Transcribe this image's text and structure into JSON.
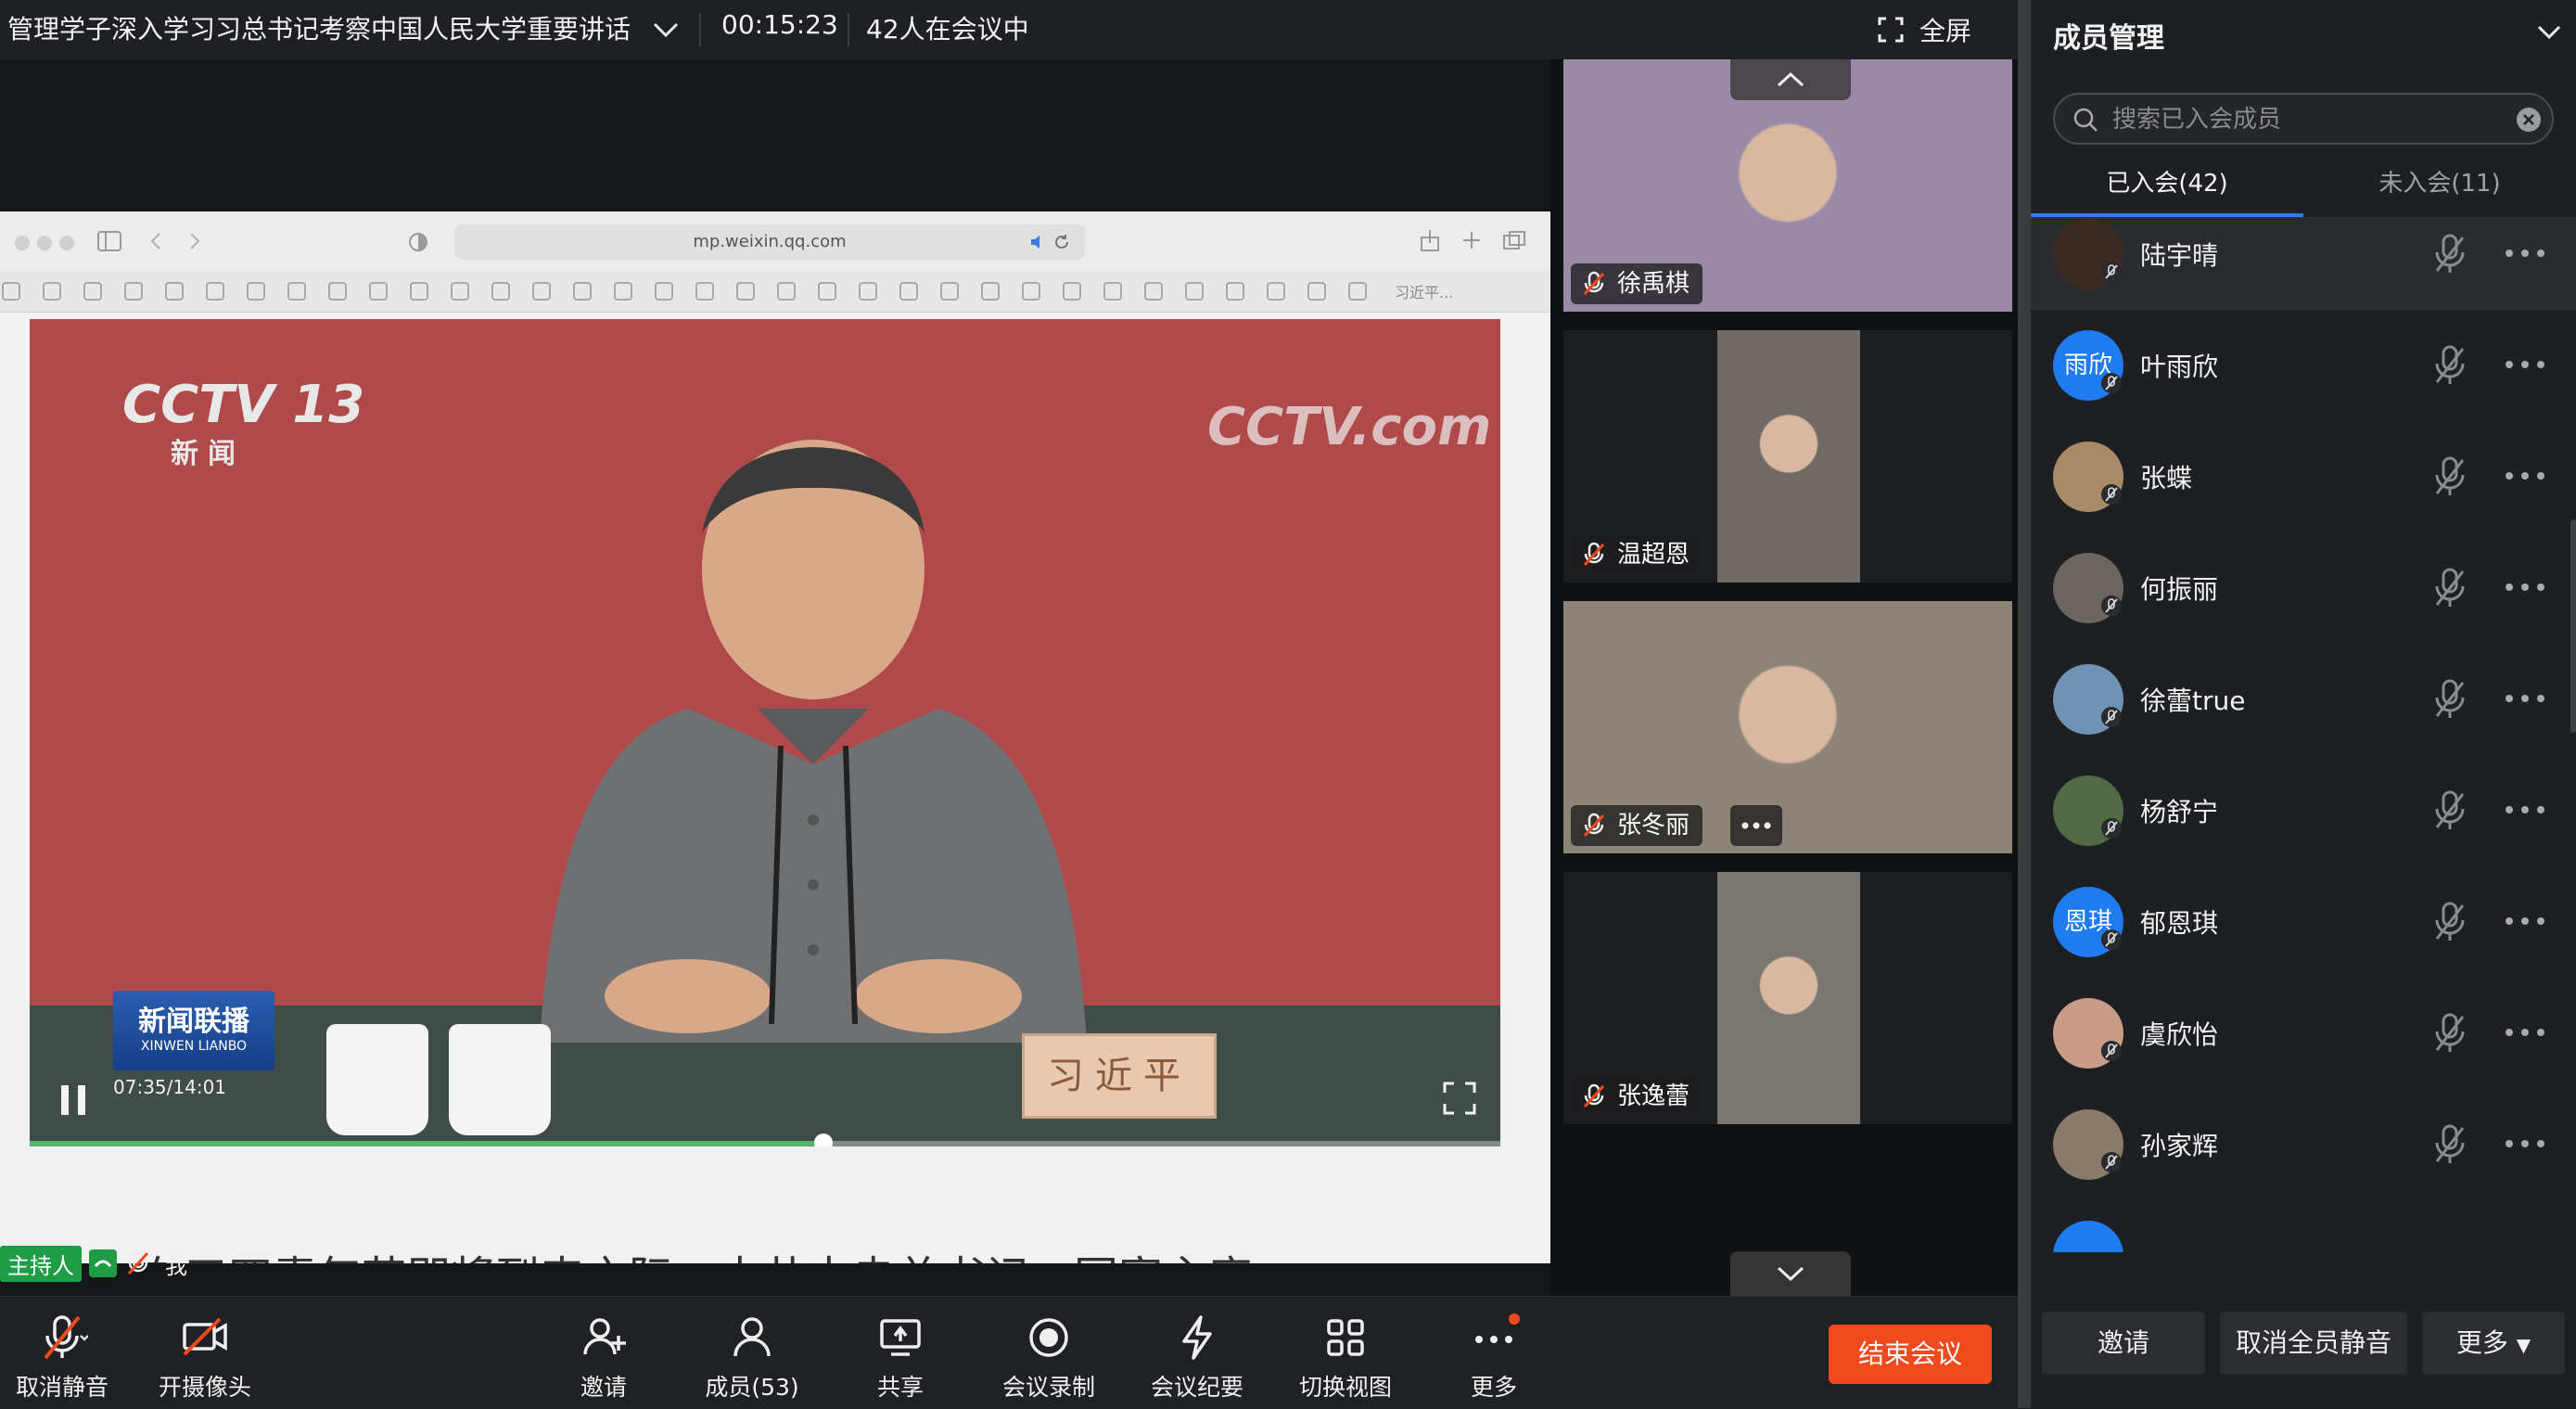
{
  "topbar": {
    "meeting_title": "管理学子深入学习习总书记考察中国人民大学重要讲话",
    "timer": "00:15:23",
    "participants": "42人在会议中",
    "fullscreen_label": "全屏"
  },
  "shared_screen": {
    "address": "mp.weixin.qq.com",
    "bookmark_label": "习近平...",
    "video": {
      "channel_logo": "CCTV 13",
      "channel_sub": "新闻",
      "watermark": "CCTV.com",
      "nameplate": "习近平",
      "program_logo": "新闻联播",
      "program_logo_sub": "XINWEN LIANBO",
      "time": "07:35/14:01",
      "progress": 0.54
    },
    "article_snippet": "在五四青年节即将到来之际，中共中央总书记、国家主席"
  },
  "host_row": {
    "host_badge": "主持人",
    "me_label": "我"
  },
  "video_tiles": [
    {
      "name": "徐禹棋",
      "bg": "#9a8aa8",
      "has_more": false
    },
    {
      "name": "温超恩",
      "bg": "#6f6a64",
      "has_more": false
    },
    {
      "name": "张冬丽",
      "bg": "#8d8478",
      "has_more": true
    },
    {
      "name": "张逸蕾",
      "bg": "#7a7672",
      "has_more": false
    }
  ],
  "toolbar": {
    "unmute": "取消静音",
    "camera": "开摄像头",
    "invite": "邀请",
    "members": "成员(53)",
    "share": "共享",
    "record": "会议录制",
    "minutes": "会议纪要",
    "switch_view": "切换视图",
    "more": "更多",
    "end_meeting": "结束会议"
  },
  "panel": {
    "title": "成员管理",
    "search_placeholder": "搜索已入会成员",
    "tab_joined": "已入会(42)",
    "tab_not_joined": "未入会(11)",
    "members": [
      {
        "name": "陆宇晴",
        "avatar_text": "",
        "avatar_bg": "#3b2a22"
      },
      {
        "name": "叶雨欣",
        "avatar_text": "雨欣",
        "avatar_bg": "#1f7cf0"
      },
      {
        "name": "张蝶",
        "avatar_text": "",
        "avatar_bg": "#a98a66"
      },
      {
        "name": "何振丽",
        "avatar_text": "",
        "avatar_bg": "#6b6560"
      },
      {
        "name": "徐蕾true",
        "avatar_text": "",
        "avatar_bg": "#6f93b5"
      },
      {
        "name": "杨舒宁",
        "avatar_text": "",
        "avatar_bg": "#4f6a45"
      },
      {
        "name": "郁恩琪",
        "avatar_text": "恩琪",
        "avatar_bg": "#1f7cf0"
      },
      {
        "name": "虞欣怡",
        "avatar_text": "",
        "avatar_bg": "#c89c86"
      },
      {
        "name": "孙家辉",
        "avatar_text": "",
        "avatar_bg": "#8a7a6a"
      }
    ],
    "footer": {
      "invite": "邀请",
      "mute_all": "取消全员静音",
      "more": "更多"
    }
  },
  "colors": {
    "accent": "#2f7cf6",
    "end_button": "#f04a1e",
    "host_badge": "#1e9c46",
    "mic_muted": "#f04a1e"
  }
}
